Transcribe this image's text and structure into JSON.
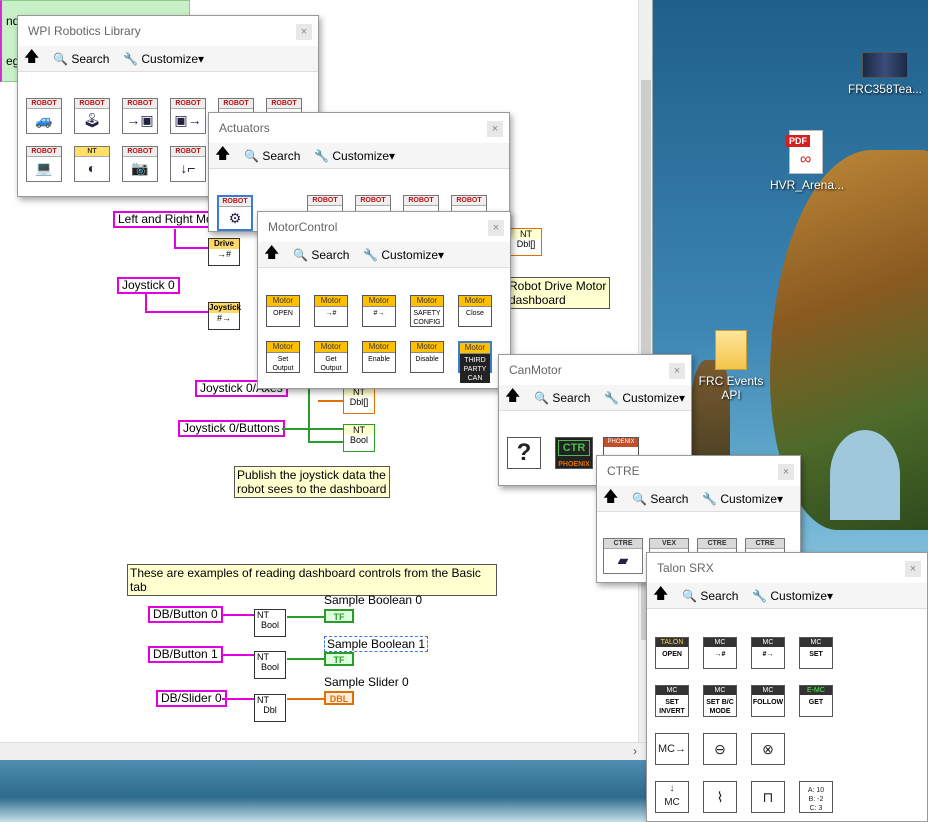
{
  "desktop": {
    "icons": [
      {
        "label": "FRC358Tea..."
      },
      {
        "label": "HVR_Arena..."
      },
      {
        "label": "FRC Events API"
      },
      {
        "label": "PDF"
      }
    ]
  },
  "diagram": {
    "green_note_lines": [
      "nd u",
      "egin"
    ],
    "labels": {
      "left_right": "Left and Right Mo",
      "joystick0": "Joystick 0",
      "joystick0_axes": "Joystick 0/Axes",
      "joystick0_buttons": "Joystick 0/Buttons",
      "db_button0": "DB/Button 0",
      "db_button1": "DB/Button 1",
      "db_slider0": "DB/Slider 0"
    },
    "comments": {
      "robot_drive": "Robot Drive Motor\ndashboard",
      "publish": "Publish the joystick data the\nrobot sees to the dashboard",
      "examples": "These are examples of reading dashboard controls from the Basic tab"
    },
    "indicators": {
      "sample_bool0": "Sample Boolean 0",
      "sample_bool1": "Sample Boolean 1",
      "sample_slider0": "Sample Slider 0",
      "tf": "TF",
      "dbl": "DBL"
    },
    "nodes": {
      "nt": "NT",
      "bool": "Bool",
      "dbl": "Dbl",
      "dbl_arr": "Dbl[]",
      "joystick": "Joystick",
      "drive": "Drive"
    }
  },
  "palettes": {
    "wpi": {
      "title": "WPI Robotics Library",
      "search": "Search",
      "customize": "Customize▾",
      "robot_tag": "ROBOT",
      "nt_tag": "NT"
    },
    "actuators": {
      "title": "Actuators",
      "search": "Search",
      "customize": "Customize▾",
      "robot_tag": "ROBOT"
    },
    "motorcontrol": {
      "title": "MotorControl",
      "search": "Search",
      "customize": "Customize▾",
      "tag": "Motor",
      "items": [
        "OPEN",
        "→#",
        "#→",
        "SAFETY CONFIG",
        "Close",
        "Set Output",
        "Get Output",
        "Enable",
        "Disable",
        "THIRD PARTY CAN"
      ]
    },
    "canmotor": {
      "title": "CanMotor",
      "search": "Search",
      "customize": "Customize▾",
      "items": [
        "?",
        "CTR",
        "PHOENIX"
      ]
    },
    "ctre": {
      "title": "CTRE",
      "search": "Search",
      "customize": "Customize▾",
      "items": [
        "CTRE",
        "VEX",
        "CTRE",
        "CTRE"
      ]
    },
    "talon": {
      "title": "Talon SRX",
      "search": "Search",
      "customize": "Customize▾",
      "row1": [
        {
          "tag": "TALON",
          "sub": "OPEN"
        },
        {
          "tag": "MC",
          "sub": "→#"
        },
        {
          "tag": "MC",
          "sub": "#→"
        },
        {
          "tag": "MC",
          "sub": "SET"
        }
      ],
      "row2": [
        {
          "tag": "MC",
          "sub": "SET INVERT"
        },
        {
          "tag": "MC",
          "sub": "SET B/C MODE"
        },
        {
          "tag": "MC",
          "sub": "FOLLOW"
        },
        {
          "tag": "E-MC",
          "sub": "GET"
        }
      ],
      "abc": "A: 10\nB: -2\nC: 3"
    }
  }
}
